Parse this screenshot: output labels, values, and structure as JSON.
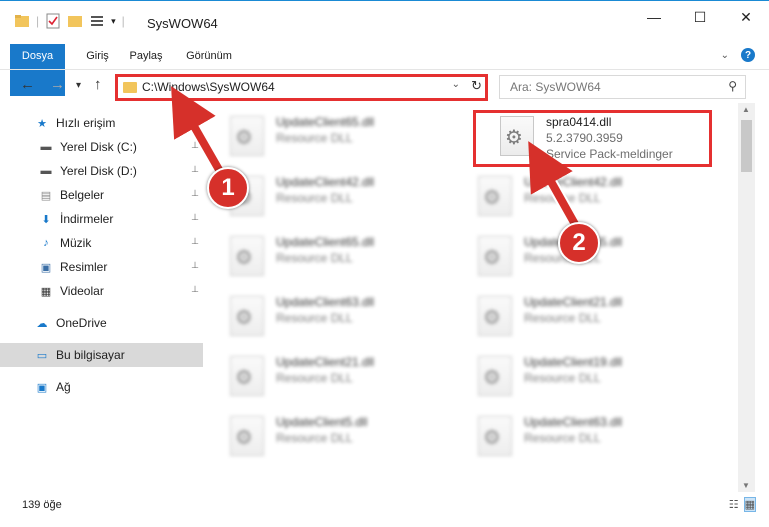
{
  "window": {
    "title": "SysWOW64",
    "controls": {
      "minimize": "—",
      "maximize": "☐",
      "close": "✕"
    }
  },
  "ribbon": {
    "tabs": [
      "Dosya",
      "Giriş",
      "Paylaş",
      "Görünüm"
    ],
    "expand_icon": "chevron-down-icon",
    "help_label": "?"
  },
  "nav": {
    "back": "←",
    "forward": "→",
    "recent": "▾",
    "up": "↑",
    "address": "C:\\Windows\\SysWOW64",
    "search_placeholder": "Ara: SysWOW64"
  },
  "sidebar": {
    "items": [
      {
        "label": "Hızlı erişim",
        "icon": "star-icon",
        "glyph": "★",
        "color": "#1979ca",
        "pinned": false
      },
      {
        "label": "Yerel Disk (C:)",
        "icon": "drive-icon",
        "glyph": "▬",
        "color": "#555555",
        "pinned": true
      },
      {
        "label": "Yerel Disk (D:)",
        "icon": "drive-icon",
        "glyph": "▬",
        "color": "#555555",
        "pinned": true
      },
      {
        "label": "Belgeler",
        "icon": "documents-icon",
        "glyph": "▤",
        "color": "#8a8a8a",
        "pinned": true
      },
      {
        "label": "İndirmeler",
        "icon": "download-icon",
        "glyph": "⬇",
        "color": "#1979ca",
        "pinned": true
      },
      {
        "label": "Müzik",
        "icon": "music-icon",
        "glyph": "♪",
        "color": "#1979ca",
        "pinned": true
      },
      {
        "label": "Resimler",
        "icon": "pictures-icon",
        "glyph": "▣",
        "color": "#3a6ea5",
        "pinned": true
      },
      {
        "label": "Videolar",
        "icon": "videos-icon",
        "glyph": "▦",
        "color": "#333333",
        "pinned": true
      },
      {
        "label": "OneDrive",
        "icon": "cloud-icon",
        "glyph": "☁",
        "color": "#1979ca",
        "pinned": false
      },
      {
        "label": "Bu bilgisayar",
        "icon": "computer-icon",
        "glyph": "▭",
        "color": "#1979ca",
        "pinned": false
      },
      {
        "label": "Ağ",
        "icon": "network-icon",
        "glyph": "▣",
        "color": "#1979ca",
        "pinned": false
      }
    ],
    "pin_glyph": "📌"
  },
  "files": {
    "highlighted": {
      "name": "spra0414.dll",
      "version": "5.2.3790.3959",
      "description": "Service Pack-meldinger"
    },
    "left_column": [
      {
        "name": "UpdateClient65.dll",
        "type": "Resource DLL"
      },
      {
        "name": "UpdateClient42.dll",
        "type": "Resource DLL"
      },
      {
        "name": "UpdateClient65.dll",
        "type": "Resource DLL"
      },
      {
        "name": "UpdateClient63.dll",
        "type": "Resource DLL"
      },
      {
        "name": "UpdateClient21.dll",
        "type": "Resource DLL"
      },
      {
        "name": "UpdateClient5.dll",
        "type": "Resource DLL"
      }
    ],
    "right_column": [
      {
        "name": "UpdateClient42.dll",
        "type": "Resource DLL"
      },
      {
        "name": "UpdateClient65.dll",
        "type": "Resource DLL"
      },
      {
        "name": "UpdateClient21.dll",
        "type": "Resource DLL"
      },
      {
        "name": "UpdateClient19.dll",
        "type": "Resource DLL"
      },
      {
        "name": "UpdateClient63.dll",
        "type": "Resource DLL"
      }
    ]
  },
  "status": {
    "count": "139 öğe"
  },
  "annotations": {
    "marker1": "1",
    "marker2": "2",
    "color": "#d6302a"
  }
}
